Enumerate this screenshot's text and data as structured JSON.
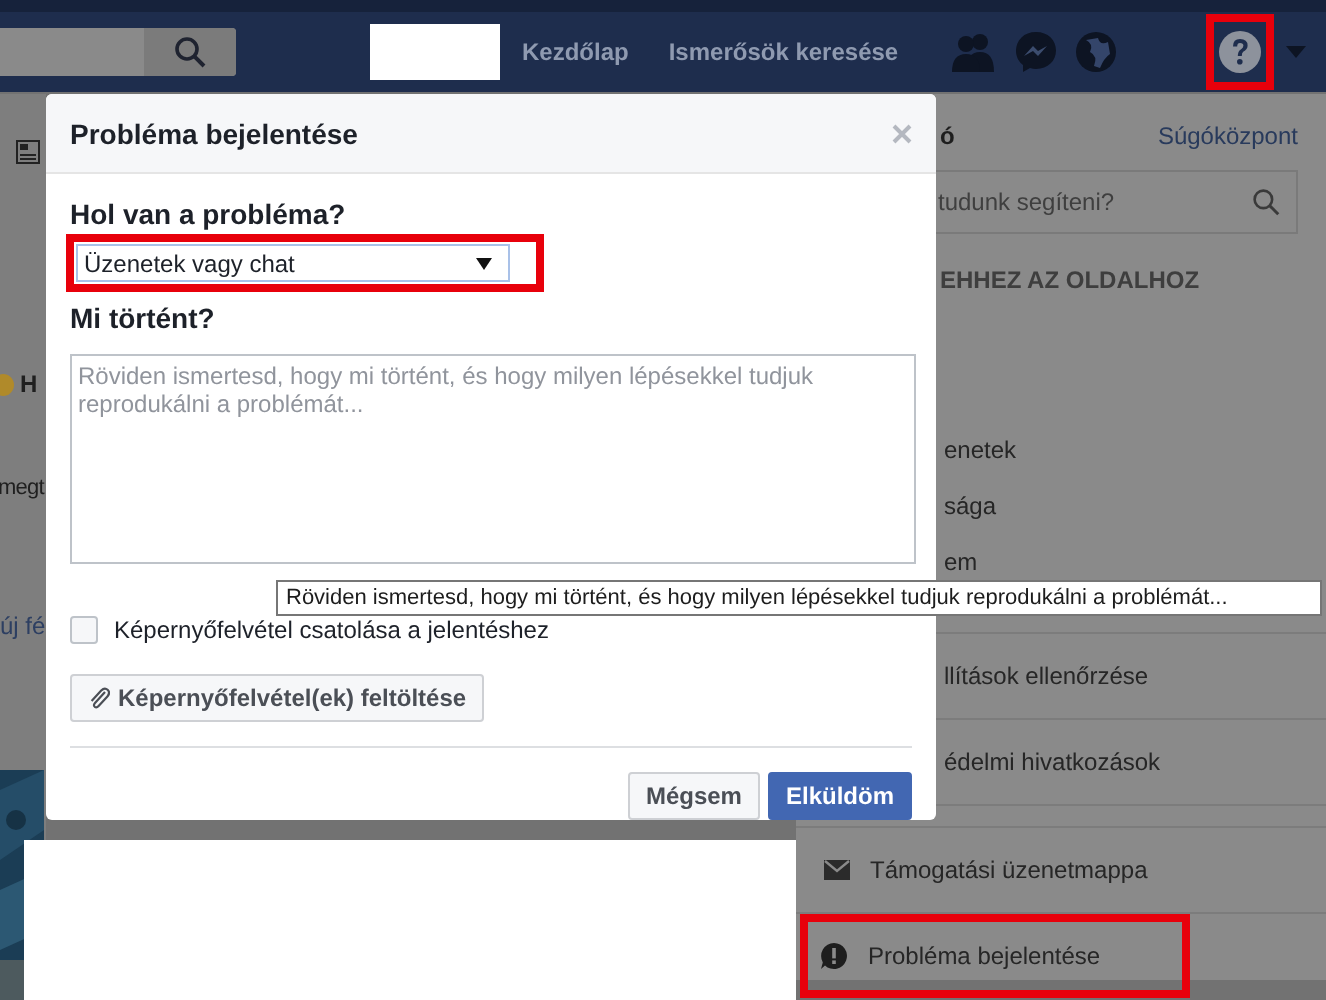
{
  "header": {
    "nav_links": [
      "Kezdőlap",
      "Ismerősök keresése"
    ],
    "help_highlighted": true
  },
  "page": {
    "fragments": [
      "H",
      "megt",
      "új fé"
    ]
  },
  "help_menu": {
    "title": "ó",
    "link": "Súgóközpont",
    "search": {
      "placeholder": "tudunk segíteni?"
    },
    "section_header": "EHHEZ AZ OLDALHOZ",
    "sections": [
      {
        "kind": "links",
        "items": [
          {
            "label": "enetek",
            "kind": "text",
            "highlighted": false
          },
          {
            "label": "sága",
            "kind": "text",
            "highlighted": false
          },
          {
            "label": "em",
            "kind": "text",
            "highlighted": false
          }
        ]
      },
      {
        "kind": "action",
        "items": [
          {
            "label": "llítások ellenőrzése",
            "kind": "text",
            "highlighted": false
          }
        ]
      },
      {
        "kind": "action",
        "items": [
          {
            "label": "édelmi hivatkozások",
            "kind": "text",
            "highlighted": false
          }
        ]
      },
      {
        "kind": "action",
        "items": [
          {
            "label": "Támogatási üzenetmappa",
            "kind": "inbox",
            "highlighted": false
          }
        ]
      },
      {
        "kind": "action",
        "items": [
          {
            "label": "Probléma bejelentése",
            "kind": "report",
            "highlighted": true
          }
        ]
      }
    ]
  },
  "dialog": {
    "title": "Probléma bejelentése",
    "where_label": "Hol van a probléma?",
    "where_value": "Üzenetek vagy chat",
    "where_highlighted": true,
    "what_label": "Mi történt?",
    "what_placeholder": "Röviden ismertesd, hogy mi történt, és hogy milyen lépésekkel tudjuk reprodukálni a problémát...",
    "screenshot_checkbox": {
      "label": "Képernyőfelvétel csatolása a jelentéshez",
      "checked": false
    },
    "upload_button": "Képernyőfelvétel(ek) feltöltése",
    "buttons": [
      {
        "label": "Mégsem",
        "kind": "secondary"
      },
      {
        "label": "Elküldöm",
        "kind": "primary"
      }
    ]
  },
  "tooltip": "Röviden ismertesd, hogy mi történt, és hogy milyen lépésekkel tudjuk reprodukálni a problémát..."
}
